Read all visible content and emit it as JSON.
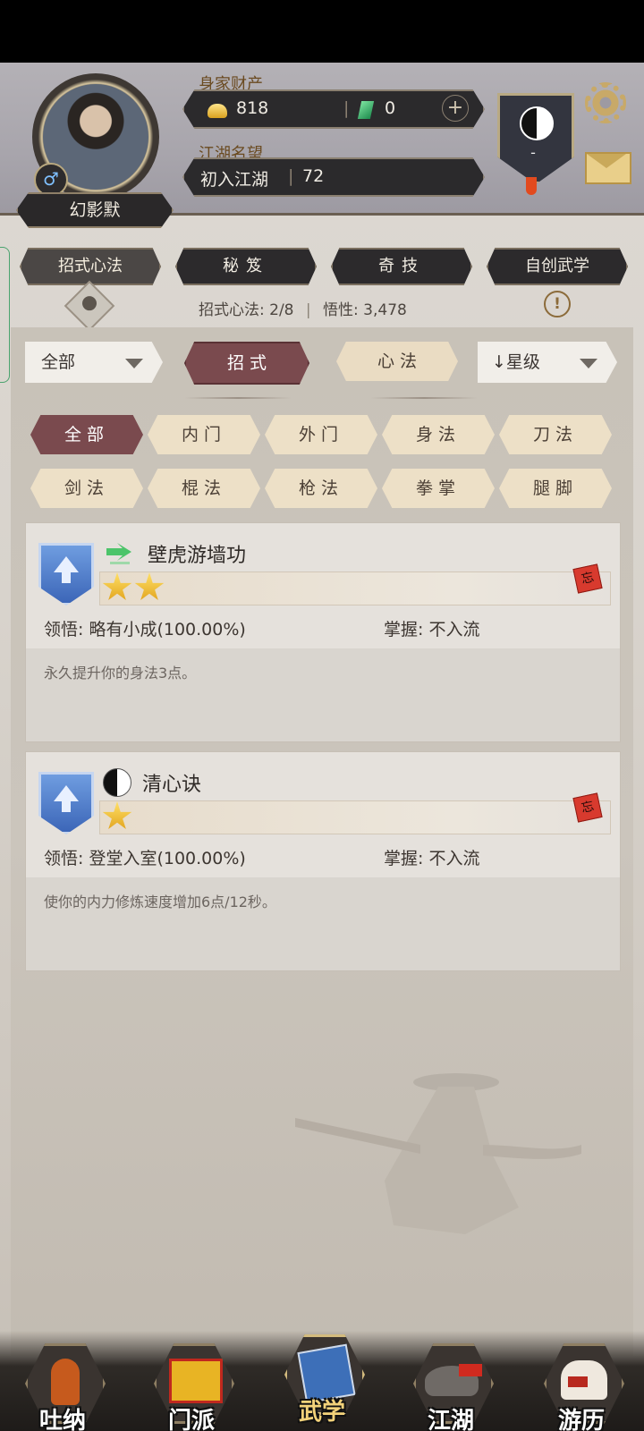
{
  "header": {
    "player_name": "幻影默",
    "wealth_label": "身家财产",
    "gold": "818",
    "jade": "0",
    "reputation_label": "江湖名望",
    "reputation_rank": "初入江湖",
    "reputation_value": "72",
    "badge_value": "-"
  },
  "category_tabs": [
    "招式心法",
    "秘笈",
    "奇技",
    "自创武学"
  ],
  "stats": {
    "skills_text": "招式心法: 2/8",
    "insight_text": "悟性: 3,478"
  },
  "filters": {
    "left_dropdown": "全部",
    "segments": [
      "招 式",
      "心 法"
    ],
    "sort_dropdown": "↓星级",
    "types_row1": [
      "全部",
      "内门",
      "外门",
      "身法",
      "刀法"
    ],
    "types_row2": [
      "剑法",
      "棍法",
      "枪法",
      "拳掌",
      "腿脚"
    ]
  },
  "skills": [
    {
      "name": "壁虎游墙功",
      "stars": 2,
      "comprehension": "领悟: 略有小成(100.00%)",
      "mastery": "掌握: 不入流",
      "description": "永久提升你的身法3点。",
      "forget_label": "忘",
      "icon": "lizard-swift-icon"
    },
    {
      "name": "清心诀",
      "stars": 1,
      "comprehension": "领悟: 登堂入室(100.00%)",
      "mastery": "掌握: 不入流",
      "description": "使你的内力修炼速度增加6点/12秒。",
      "forget_label": "忘",
      "icon": "yin-yang-icon"
    }
  ],
  "bottom_nav": [
    "吐纳",
    "门派",
    "武学",
    "江湖",
    "游历"
  ],
  "colors": {
    "accent": "#7a4a4e",
    "tab_dark": "#2c2a2c",
    "gold": "#e0a11a"
  }
}
